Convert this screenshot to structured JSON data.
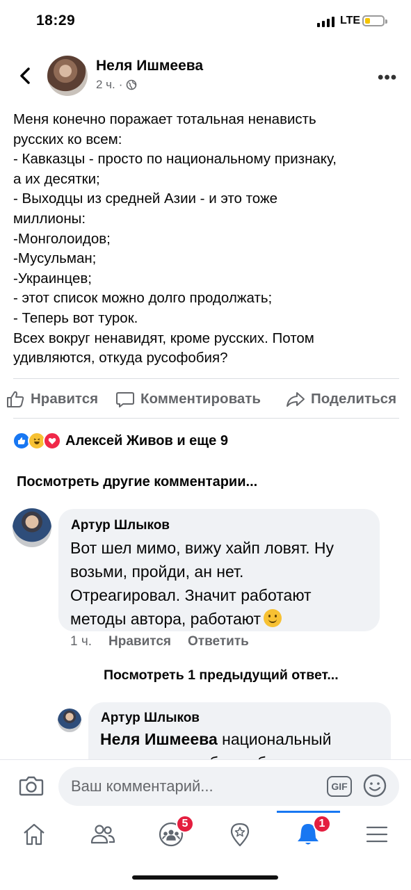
{
  "status_bar": {
    "time": "18:29",
    "network": "LTE",
    "battery_color": "#f5c400"
  },
  "post": {
    "author": "Неля Ишмеева",
    "time": "2 ч.",
    "privacy_icon": "globe-icon",
    "text": "Меня конечно поражает тотальная ненависть\nрусских ко всем:\n- Кавказцы - просто по национальному признаку,\nа их десятки;\n- Выходцы из средней Азии - и это тоже\nмиллионы:\n-Монголоидов;\n-Мусульман;\n-Украинцев;\n- этот список можно долго продолжать;\n- Теперь вот турок.\nВсех вокруг ненавидят, кроме русских. Потом\nудивляются, откуда русофобия?"
  },
  "actions": {
    "like": "Нравится",
    "comment": "Комментировать",
    "share": "Поделиться"
  },
  "reactions": {
    "icons": [
      "like",
      "haha",
      "love"
    ],
    "summary": "Алексей Живов и еще 9"
  },
  "view_more": "Посмотреть другие комментарии...",
  "comments": [
    {
      "author": "Артур Шлыков",
      "text": "Вот шел мимо, вижу хайп ловят. Ну\nвозьми, пройди, ан нет.\nОтреагировал. Значит работают\nметоды автора, работают",
      "time": "1 ч.",
      "like": "Нравится",
      "reply": "Ответить"
    }
  ],
  "previous_replies": "Посмотреть 1 предыдущий ответ...",
  "reply": {
    "author": "Артур Шлыков",
    "mention": "Неля Ишмеева",
    "text": " национальный\nвопрос всегда был и будет"
  },
  "composer": {
    "placeholder": "Ваш комментарий...",
    "gif": "GIF"
  },
  "nav": {
    "groups_badge": "5",
    "notifications_badge": "1",
    "accent": "#1877f2"
  }
}
